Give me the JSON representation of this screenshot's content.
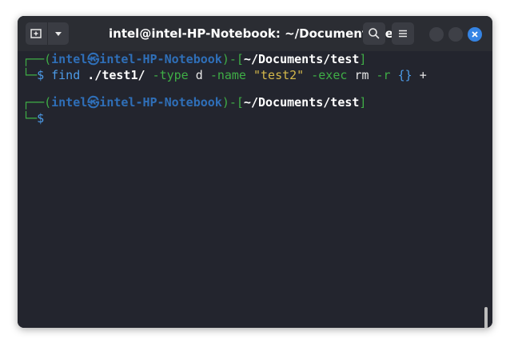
{
  "window": {
    "title": "intel@intel-HP-Notebook: ~/Documents/test"
  },
  "titlebar": {
    "new_tab_icon": "new-tab-icon",
    "dropdown_icon": "chevron-down-icon",
    "search_icon": "search-icon",
    "menu_icon": "hamburger-menu-icon",
    "close_icon": "close-icon"
  },
  "prompt1": {
    "corner": "┌──(",
    "user": "intel",
    "sep": "㉿",
    "host": "intel-HP-Notebook",
    "mid": ")-[",
    "path": "~/Documents/test",
    "end": "]",
    "arrow": "└─",
    "dollar": "$",
    "command": {
      "cmd": "find",
      "path": "./test1/",
      "opt1": "-type",
      "val1": "d",
      "opt2": "-name",
      "val2": "\"test2\"",
      "opt3": "-exec",
      "val3": "rm",
      "opt4": "-r",
      "braces": "{}",
      "plus": "+"
    }
  },
  "prompt2": {
    "corner": "┌──(",
    "user": "intel",
    "sep": "㉿",
    "host": "intel-HP-Notebook",
    "mid": ")-[",
    "path": "~/Documents/test",
    "end": "]",
    "arrow": "└─",
    "dollar": "$"
  },
  "colors": {
    "background": "#23252e",
    "titlebar": "#2b2d33",
    "prompt_green": "#3fae46",
    "prompt_blue": "#2f6fb8",
    "accent": "#3584e4"
  }
}
